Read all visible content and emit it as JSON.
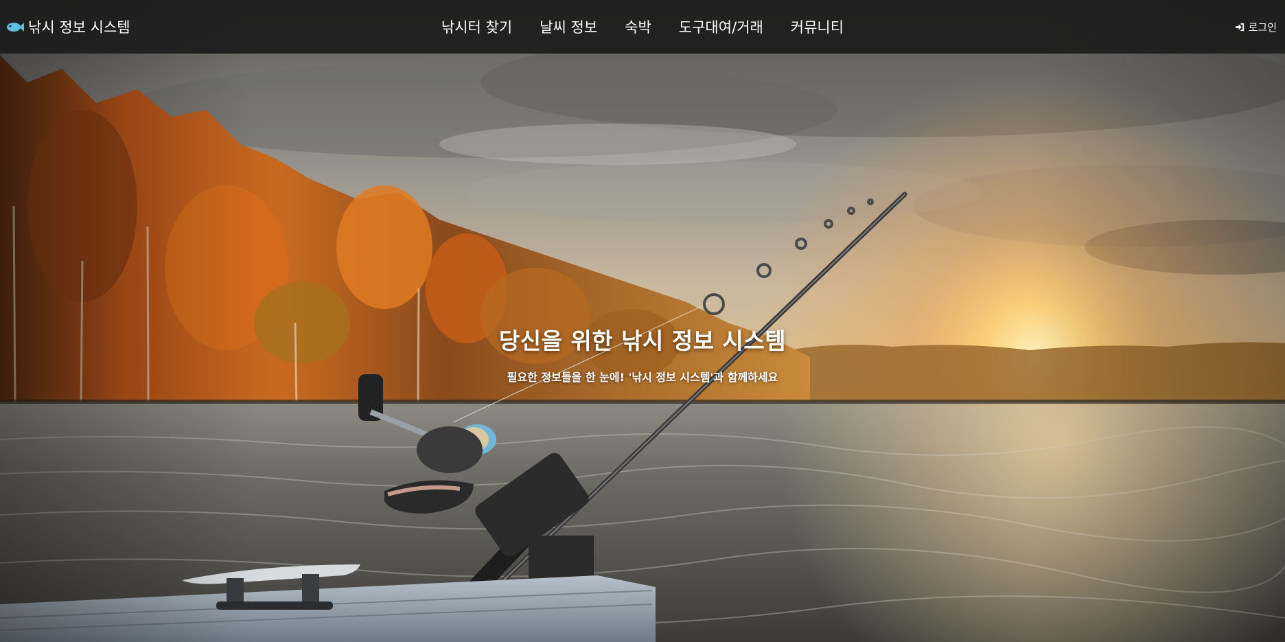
{
  "brand": {
    "icon": "fish-icon",
    "title": "낚시 정보 시스템"
  },
  "nav": {
    "items": [
      {
        "label": "낚시터 찾기"
      },
      {
        "label": "날씨 정보"
      },
      {
        "label": "숙박"
      },
      {
        "label": "도구대여/거래"
      },
      {
        "label": "커뮤니티"
      }
    ]
  },
  "login": {
    "icon": "sign-in-icon",
    "label": "로그인"
  },
  "hero": {
    "title": "당신을 위한 낚시 정보 시스템",
    "subtitle": "필요한 정보들을 한 눈에! '낚시 정보 시스템'과 함께하세요"
  },
  "colors": {
    "navbar_bg": "#1c1c1c",
    "fish_icon": "#5bc0de",
    "text": "#ffffff"
  }
}
